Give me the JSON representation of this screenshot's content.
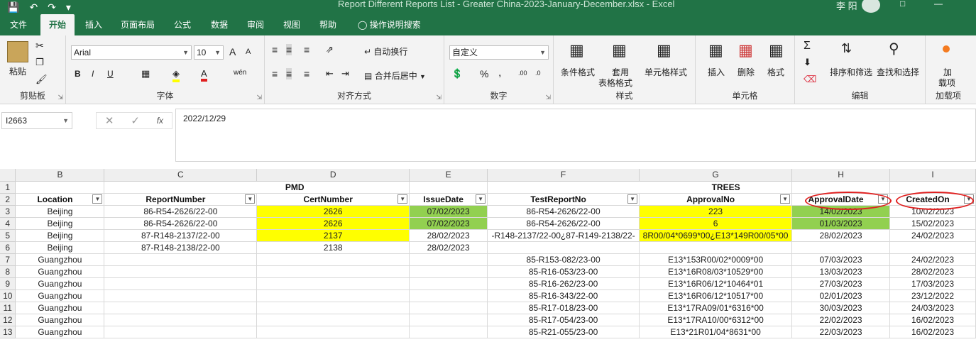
{
  "titlebar": {
    "title": "Report Different Reports List - Greater China-2023-January-December.xlsx  -  Excel",
    "user": "李 阳"
  },
  "menu": {
    "tabs": [
      "文件",
      "开始",
      "插入",
      "页面布局",
      "公式",
      "数据",
      "审阅",
      "视图",
      "帮助",
      "操作说明搜索"
    ]
  },
  "ribbon": {
    "clipboard": {
      "label": "剪贴板",
      "paste": "粘贴"
    },
    "font": {
      "label": "字体",
      "name": "Arial",
      "size": "10",
      "bold": "B",
      "italic": "I",
      "underline": "U",
      "grow": "A",
      "shrink": "A",
      "phonetic": "wén"
    },
    "align": {
      "label": "对齐方式",
      "wrap": "自动换行",
      "merge": "合并后居中"
    },
    "number": {
      "label": "数字",
      "format": "自定义",
      "percent": "%",
      "comma": ","
    },
    "styles": {
      "label": "样式",
      "cond": "条件格式",
      "table_l1": "套用",
      "table_l2": "表格格式",
      "cell": "单元格样式"
    },
    "cells": {
      "label": "单元格",
      "insert": "插入",
      "delete": "删除",
      "format": "格式"
    },
    "editing": {
      "label": "编辑",
      "sort": "排序和筛选",
      "find": "查找和选择"
    },
    "addins": {
      "label": "加载项",
      "btn_l1": "加",
      "btn_l2": "载项"
    }
  },
  "formula": {
    "namebox": "I2663",
    "fx": "fx",
    "value": "2022/12/29"
  },
  "sheet": {
    "columns": [
      "B",
      "C",
      "D",
      "E",
      "F",
      "G",
      "H",
      "I"
    ],
    "row1": {
      "d": "PMD",
      "g": "TREES"
    },
    "headers": [
      "Location",
      "ReportNumber",
      "CertNumber",
      "IssueDate",
      "TestReportNo",
      "ApprovalNo",
      "ApprovalDate",
      "CreatedOn"
    ],
    "rows": [
      {
        "n": "3",
        "b": "Beijing",
        "c": "86-R54-2626/22-00",
        "d": "2626",
        "e": "07/02/2023",
        "f": "86-R54-2626/22-00",
        "g": "223",
        "h": "14/02/2023",
        "i": "10/02/2023"
      },
      {
        "n": "4",
        "b": "Beijing",
        "c": "86-R54-2626/22-00",
        "d": "2626",
        "e": "07/02/2023",
        "f": "86-R54-2626/22-00",
        "g": "6",
        "h": "01/03/2023",
        "i": "15/02/2023"
      },
      {
        "n": "5",
        "b": "Beijing",
        "c": "87-R148-2137/22-00",
        "d": "2137",
        "e": "28/02/2023",
        "f": "-R148-2137/22-00¿87-R149-2138/22-",
        "g": "8R00/04*0699*00¿E13*149R00/05*00",
        "h": "28/02/2023",
        "i": "24/02/2023"
      },
      {
        "n": "6",
        "b": "Beijing",
        "c": "87-R148-2138/22-00",
        "d": "2138",
        "e": "28/02/2023",
        "f": "",
        "g": "",
        "h": "",
        "i": ""
      },
      {
        "n": "7",
        "b": "Guangzhou",
        "c": "",
        "d": "",
        "e": "",
        "f": "85-R153-082/23-00",
        "g": "E13*153R00/02*0009*00",
        "h": "07/03/2023",
        "i": "24/02/2023"
      },
      {
        "n": "8",
        "b": "Guangzhou",
        "c": "",
        "d": "",
        "e": "",
        "f": "85-R16-053/23-00",
        "g": "E13*16R08/03*10529*00",
        "h": "13/03/2023",
        "i": "28/02/2023"
      },
      {
        "n": "9",
        "b": "Guangzhou",
        "c": "",
        "d": "",
        "e": "",
        "f": "85-R16-262/23-00",
        "g": "E13*16R06/12*10464*01",
        "h": "27/03/2023",
        "i": "17/03/2023"
      },
      {
        "n": "10",
        "b": "Guangzhou",
        "c": "",
        "d": "",
        "e": "",
        "f": "85-R16-343/22-00",
        "g": "E13*16R06/12*10517*00",
        "h": "02/01/2023",
        "i": "23/12/2022"
      },
      {
        "n": "11",
        "b": "Guangzhou",
        "c": "",
        "d": "",
        "e": "",
        "f": "85-R17-018/23-00",
        "g": "E13*17RA09/01*6316*00",
        "h": "30/03/2023",
        "i": "24/03/2023"
      },
      {
        "n": "12",
        "b": "Guangzhou",
        "c": "",
        "d": "",
        "e": "",
        "f": "85-R17-054/23-00",
        "g": "E13*17RA10/00*6312*00",
        "h": "22/02/2023",
        "i": "16/02/2023"
      },
      {
        "n": "13",
        "b": "Guangzhou",
        "c": "",
        "d": "",
        "e": "",
        "f": "85-R21-055/23-00",
        "g": "E13*21R01/04*8631*00",
        "h": "22/03/2023",
        "i": "16/02/2023"
      }
    ]
  },
  "colors": {
    "excel_green": "#217346",
    "highlight_yellow": "#ffff00",
    "highlight_green": "#92d050",
    "annotation_red": "#e02020"
  }
}
